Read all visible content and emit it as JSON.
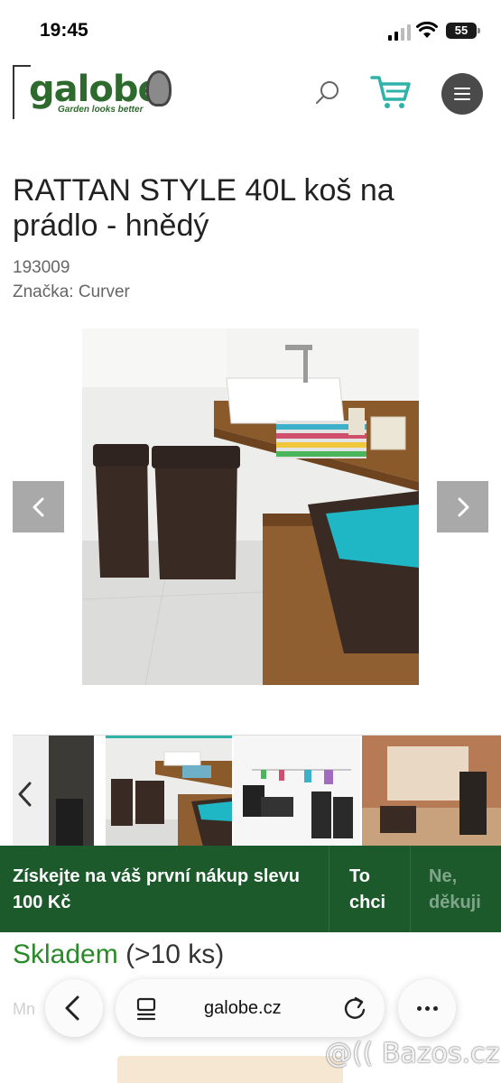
{
  "status_bar": {
    "time": "19:45",
    "battery": "55"
  },
  "header": {
    "logo_text": "galobe",
    "logo_tagline": "Garden looks better",
    "search_icon": "search-icon",
    "cart_icon": "cart-icon",
    "menu_icon": "hamburger-icon",
    "accent_color": "#2e6a2e"
  },
  "product": {
    "title": "RATTAN STYLE 40L koš na prádlo - hnědý",
    "sku": "193009",
    "brand": "Značka: Curver",
    "stock_status": "Skladem",
    "stock_qty": "(>10 ks)"
  },
  "gallery": {
    "prev_icon": "chevron-left-icon",
    "next_icon": "chevron-right-icon"
  },
  "promo": {
    "text": "Získejte na váš první nákup slevu 100 Kč",
    "accept_label": "To chci",
    "decline_label": "Ne, děkuji",
    "background": "#1c5a2c"
  },
  "browser": {
    "url": "galobe.cz",
    "back_icon": "back-icon",
    "reader_icon": "reader-icon",
    "reload_icon": "reload-icon",
    "more_icon": "more-icon"
  },
  "watermark": "@(( Bazos.cz"
}
